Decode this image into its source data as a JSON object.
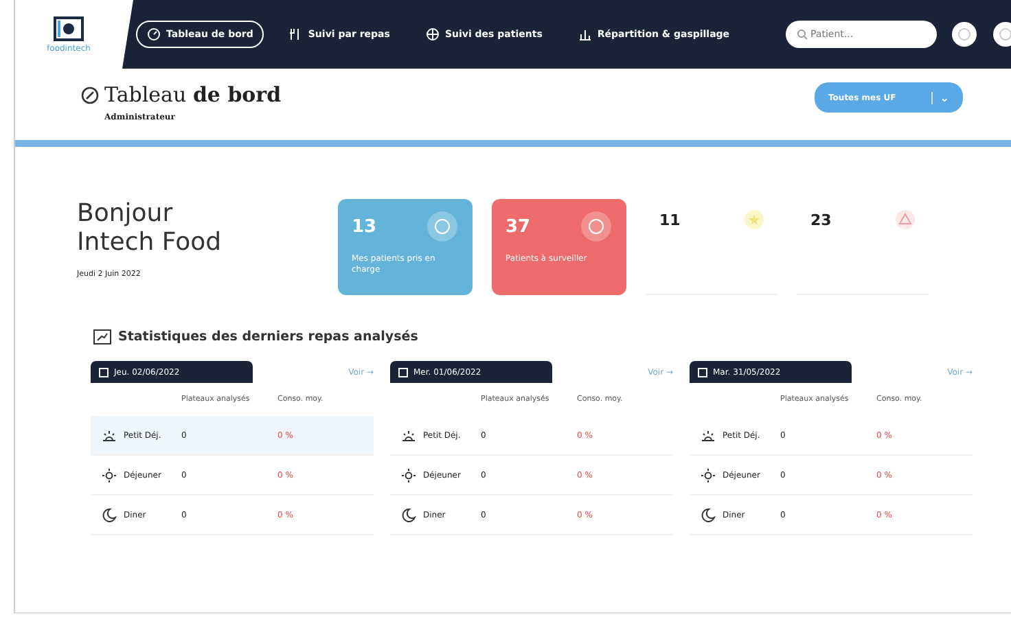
{
  "logo": {
    "text": "foodintech"
  },
  "nav": [
    {
      "label": "Tableau de bord",
      "selected": true
    },
    {
      "label": "Suivi par repas",
      "selected": false
    },
    {
      "label": "Suivi des patients",
      "selected": false
    },
    {
      "label": "Répartition & gaspillage",
      "selected": false
    }
  ],
  "search": {
    "placeholder": "Patient..."
  },
  "header": {
    "title_light": "Tableau",
    "title_bold": "de bord",
    "subtitle": "Administrateur",
    "dropdown": "Toutes mes UF",
    "dropdown_caret": "⌄"
  },
  "greeting": {
    "line1": "Bonjour",
    "line2": "Intech Food",
    "date": "Jeudi 2 Juin 2022"
  },
  "stats": [
    {
      "value": "13",
      "label": "Mes patients pris en charge",
      "kind": "blue"
    },
    {
      "value": "37",
      "label": "Patients à surveiller",
      "kind": "red"
    },
    {
      "value": "11",
      "kind": "goal"
    },
    {
      "value": "23",
      "kind": "alert"
    }
  ],
  "section_title": "Statistiques des derniers repas analysés",
  "days": [
    {
      "date": "Jeu. 02/06/2022",
      "link": "Voir →",
      "col1": "Plateaux analysés",
      "col2": "Conso. moy.",
      "rows": [
        {
          "meal": "Petit Déj.",
          "count": "0",
          "pct": "0 %",
          "selected": true
        },
        {
          "meal": "Déjeuner",
          "count": "0",
          "pct": "0 %",
          "selected": false
        },
        {
          "meal": "Diner",
          "count": "0",
          "pct": "0 %",
          "selected": false
        }
      ]
    },
    {
      "date": "Mer. 01/06/2022",
      "link": "Voir →",
      "col1": "Plateaux analysés",
      "col2": "Conso. moy.",
      "rows": [
        {
          "meal": "Petit Déj.",
          "count": "0",
          "pct": "0 %",
          "selected": false
        },
        {
          "meal": "Déjeuner",
          "count": "0",
          "pct": "0 %",
          "selected": false
        },
        {
          "meal": "Diner",
          "count": "0",
          "pct": "0 %",
          "selected": false
        }
      ]
    },
    {
      "date": "Mar. 31/05/2022",
      "link": "Voir →",
      "col1": "Plateaux analysés",
      "col2": "Conso. moy.",
      "rows": [
        {
          "meal": "Petit Déj.",
          "count": "0",
          "pct": "0 %",
          "selected": false
        },
        {
          "meal": "Déjeuner",
          "count": "0",
          "pct": "0 %",
          "selected": false
        },
        {
          "meal": "Diner",
          "count": "0",
          "pct": "0 %",
          "selected": false
        }
      ]
    }
  ]
}
